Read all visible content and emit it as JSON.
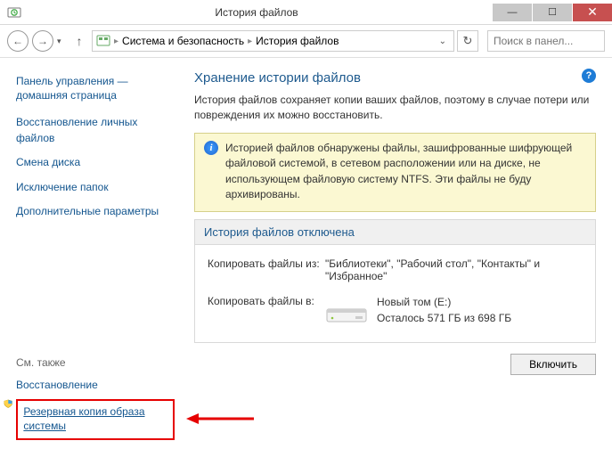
{
  "titlebar": {
    "title": "История файлов"
  },
  "addressbar": {
    "seg1": "Система и безопасность",
    "seg2": "История файлов",
    "search_placeholder": "Поиск в панел..."
  },
  "sidebar": {
    "cp_home": "Панель управления — домашняя страница",
    "items": [
      "Восстановление личных файлов",
      "Смена диска",
      "Исключение папок",
      "Дополнительные параметры"
    ],
    "see_also": "См. также",
    "recovery": "Восстановление",
    "system_image_backup": "Резервная копия образа системы"
  },
  "main": {
    "title": "Хранение истории файлов",
    "desc": "История файлов сохраняет копии ваших файлов, поэтому в случае потери или повреждения их можно восстановить.",
    "info": "Историей файлов обнаружены файлы, зашифрованные шифрующей файловой системой, в сетевом расположении или на диске, не использующем файловую систему NTFS. Эти файлы не буду архивированы.",
    "status_header": "История файлов отключена",
    "copy_from_label": "Копировать файлы из:",
    "copy_from_value": "\"Библиотеки\", \"Рабочий стол\", \"Контакты\" и \"Избранное\"",
    "copy_to_label": "Копировать файлы в:",
    "drive_name": "Новый том (E:)",
    "drive_space": "Осталось 571 ГБ из 698 ГБ",
    "enable_button": "Включить"
  }
}
